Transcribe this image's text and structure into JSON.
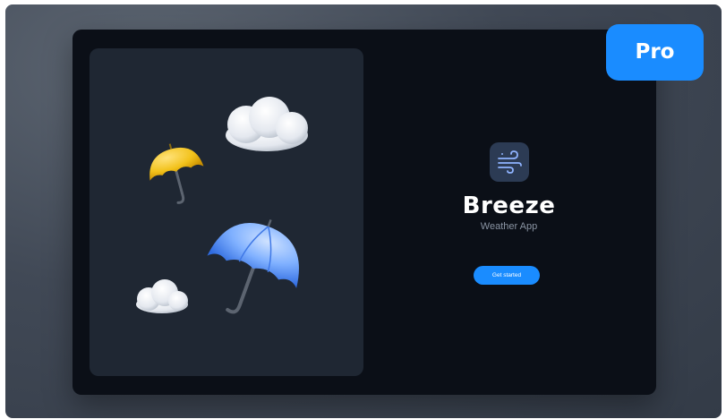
{
  "badge": {
    "label": "Pro"
  },
  "app": {
    "name": "Breeze",
    "subtitle": "Weather App",
    "cta_label": "Get started",
    "icon": "wind-icon"
  },
  "illustration": {
    "items": [
      "cloud-icon",
      "yellow-umbrella-icon",
      "blue-umbrella-icon",
      "small-cloud-icon"
    ]
  },
  "colors": {
    "background": "#414956",
    "window": "#0b0f17",
    "panel": "#1f2733",
    "accent": "#1a8cff",
    "app_icon_bg": "#2c3b54",
    "subtitle": "#8a94a3"
  }
}
